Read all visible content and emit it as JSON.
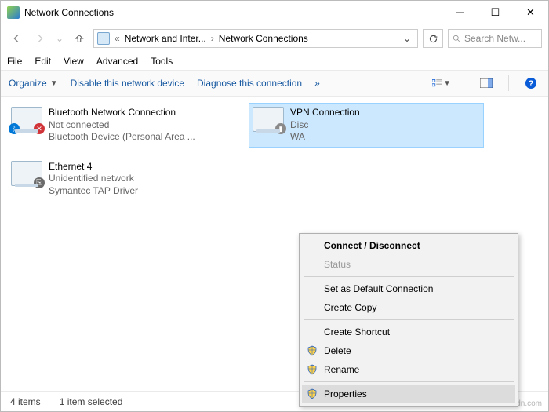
{
  "window": {
    "title": "Network Connections"
  },
  "breadcrumb": {
    "level1": "Network and Inter...",
    "level2": "Network Connections"
  },
  "search": {
    "placeholder": "Search Netw..."
  },
  "menu": {
    "file": "File",
    "edit": "Edit",
    "view": "View",
    "advanced": "Advanced",
    "tools": "Tools"
  },
  "cmd": {
    "organize": "Organize",
    "disable": "Disable this network device",
    "diagnose": "Diagnose this connection",
    "more": "»"
  },
  "items": {
    "bt": {
      "name": "Bluetooth Network Connection",
      "status": "Not connected",
      "device": "Bluetooth Device (Personal Area ..."
    },
    "eth": {
      "name": "Ethernet 4",
      "status": "Unidentified network",
      "device": "Symantec TAP Driver"
    },
    "vpn": {
      "name": "VPN Connection",
      "status": "Disc",
      "device": "WA"
    }
  },
  "ctx": {
    "connect": "Connect / Disconnect",
    "status": "Status",
    "default": "Set as Default Connection",
    "copy": "Create Copy",
    "shortcut": "Create Shortcut",
    "delete": "Delete",
    "rename": "Rename",
    "properties": "Properties"
  },
  "statusbar": {
    "count": "4 items",
    "sel": "1 item selected"
  },
  "watermark": "wsxdn.com"
}
